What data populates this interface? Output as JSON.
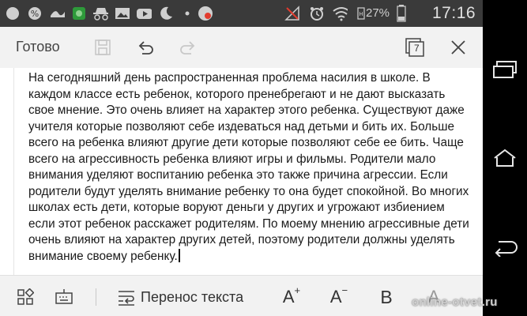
{
  "status_bar": {
    "battery_percent": "27%",
    "time": "17:16",
    "icons": [
      "circle-icon",
      "percent-icon",
      "logo-icon",
      "game-icon",
      "incognito-icon",
      "image-icon",
      "youtube-icon",
      "moon-icon",
      "notification-icon",
      "no-signal-icon",
      "alarm-icon",
      "wifi-icon",
      "sim-icon",
      "battery-icon"
    ]
  },
  "toolbar": {
    "done_label": "Готово",
    "tabs_count": "7"
  },
  "document": {
    "text": "На сегодняшний день распространенная проблема насилия в школе. В\nкаждом классе есть ребенок, которого пренебрегают и не дают высказать\nсвое мнение. Это очень влияет на характер этого ребенка. Существуют даже\nучителя которые позволяют себе издеваться над детьми и бить их. Больше\nвсего на ребенка влияют другие дети которые позволяют себе ее бить. Чаще\nвсего на агрессивность ребенка влияют игры и фильмы. Родители мало\nвнимания уделяют воспитанию ребенка это также причина агрессии. Если\nродители будут уделять внимание ребенку то она будет спокойной. Во многих\nшколах есть дети, которые воруют деньги у других и угрожают избиением\nесли этот ребенок расскажет родителям. По моему мнению агрессивные дети\nочень влияют на характер других детей, поэтому родители должны уделять\nвнимание своему ребенку."
  },
  "bottom_bar": {
    "wrap_label": "Перенос текста",
    "font_increase": "A",
    "font_decrease": "A",
    "bold": "B",
    "font_color": "A"
  },
  "watermark": "online-otvet.ru",
  "colors": {
    "status_bar": "#3a3a3a",
    "toolbar": "#f2f2f2",
    "nav_bar": "#000000"
  }
}
